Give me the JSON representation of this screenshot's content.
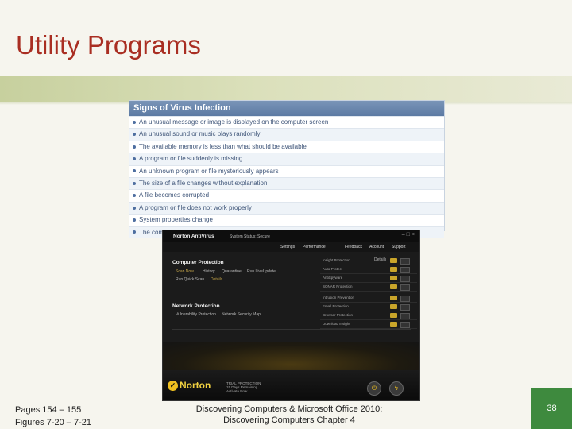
{
  "slide": {
    "title": "Utility Programs",
    "page_number": "38",
    "footer_left": [
      "Pages 154 – 155",
      "Figures 7-20 – 7-21"
    ],
    "footer_center": [
      "Discovering Computers & Microsoft Office 2010:",
      "Discovering Computers Chapter 4"
    ]
  },
  "virus_table": {
    "header": "Signs of Virus Infection",
    "rows": [
      "An unusual message or image is displayed on the computer screen",
      "An unusual sound or music plays randomly",
      "The available memory is less than what should be available",
      "A program or file suddenly is missing",
      "An unknown program or file mysteriously appears",
      "The size of a file changes without explanation",
      "A file becomes corrupted",
      "A program or file does not work properly",
      "System properties change",
      "The computer operates much slower than usual"
    ]
  },
  "norton": {
    "brand": "Norton AntiVirus",
    "status": "System Status: Secure",
    "menu": [
      "Settings",
      "Performance",
      "Feedback",
      "Account",
      "Support"
    ],
    "computer_protection": {
      "heading": "Computer Protection",
      "links_row1": [
        "Scan Now",
        "History",
        "Quarantine",
        "Run LiveUpdate"
      ],
      "links_row2": [
        "Run Quick Scan",
        "Details"
      ],
      "rows": [
        "Auto-Protect",
        "AntiSpyware",
        "SONAR Protection",
        "Insight Protection"
      ],
      "details_label": "Details"
    },
    "network_protection": {
      "heading": "Network Protection",
      "links": [
        "Vulnerability Protection",
        "Network Security Map"
      ],
      "rows": [
        "Intrusion Prevention",
        "Email Protection",
        "Browser Protection",
        "Download Insight"
      ]
    },
    "trial_text": [
      "TRIAL PROTECTION",
      "15 Days Remaining",
      "Activate Now"
    ],
    "logo": "Norton"
  }
}
